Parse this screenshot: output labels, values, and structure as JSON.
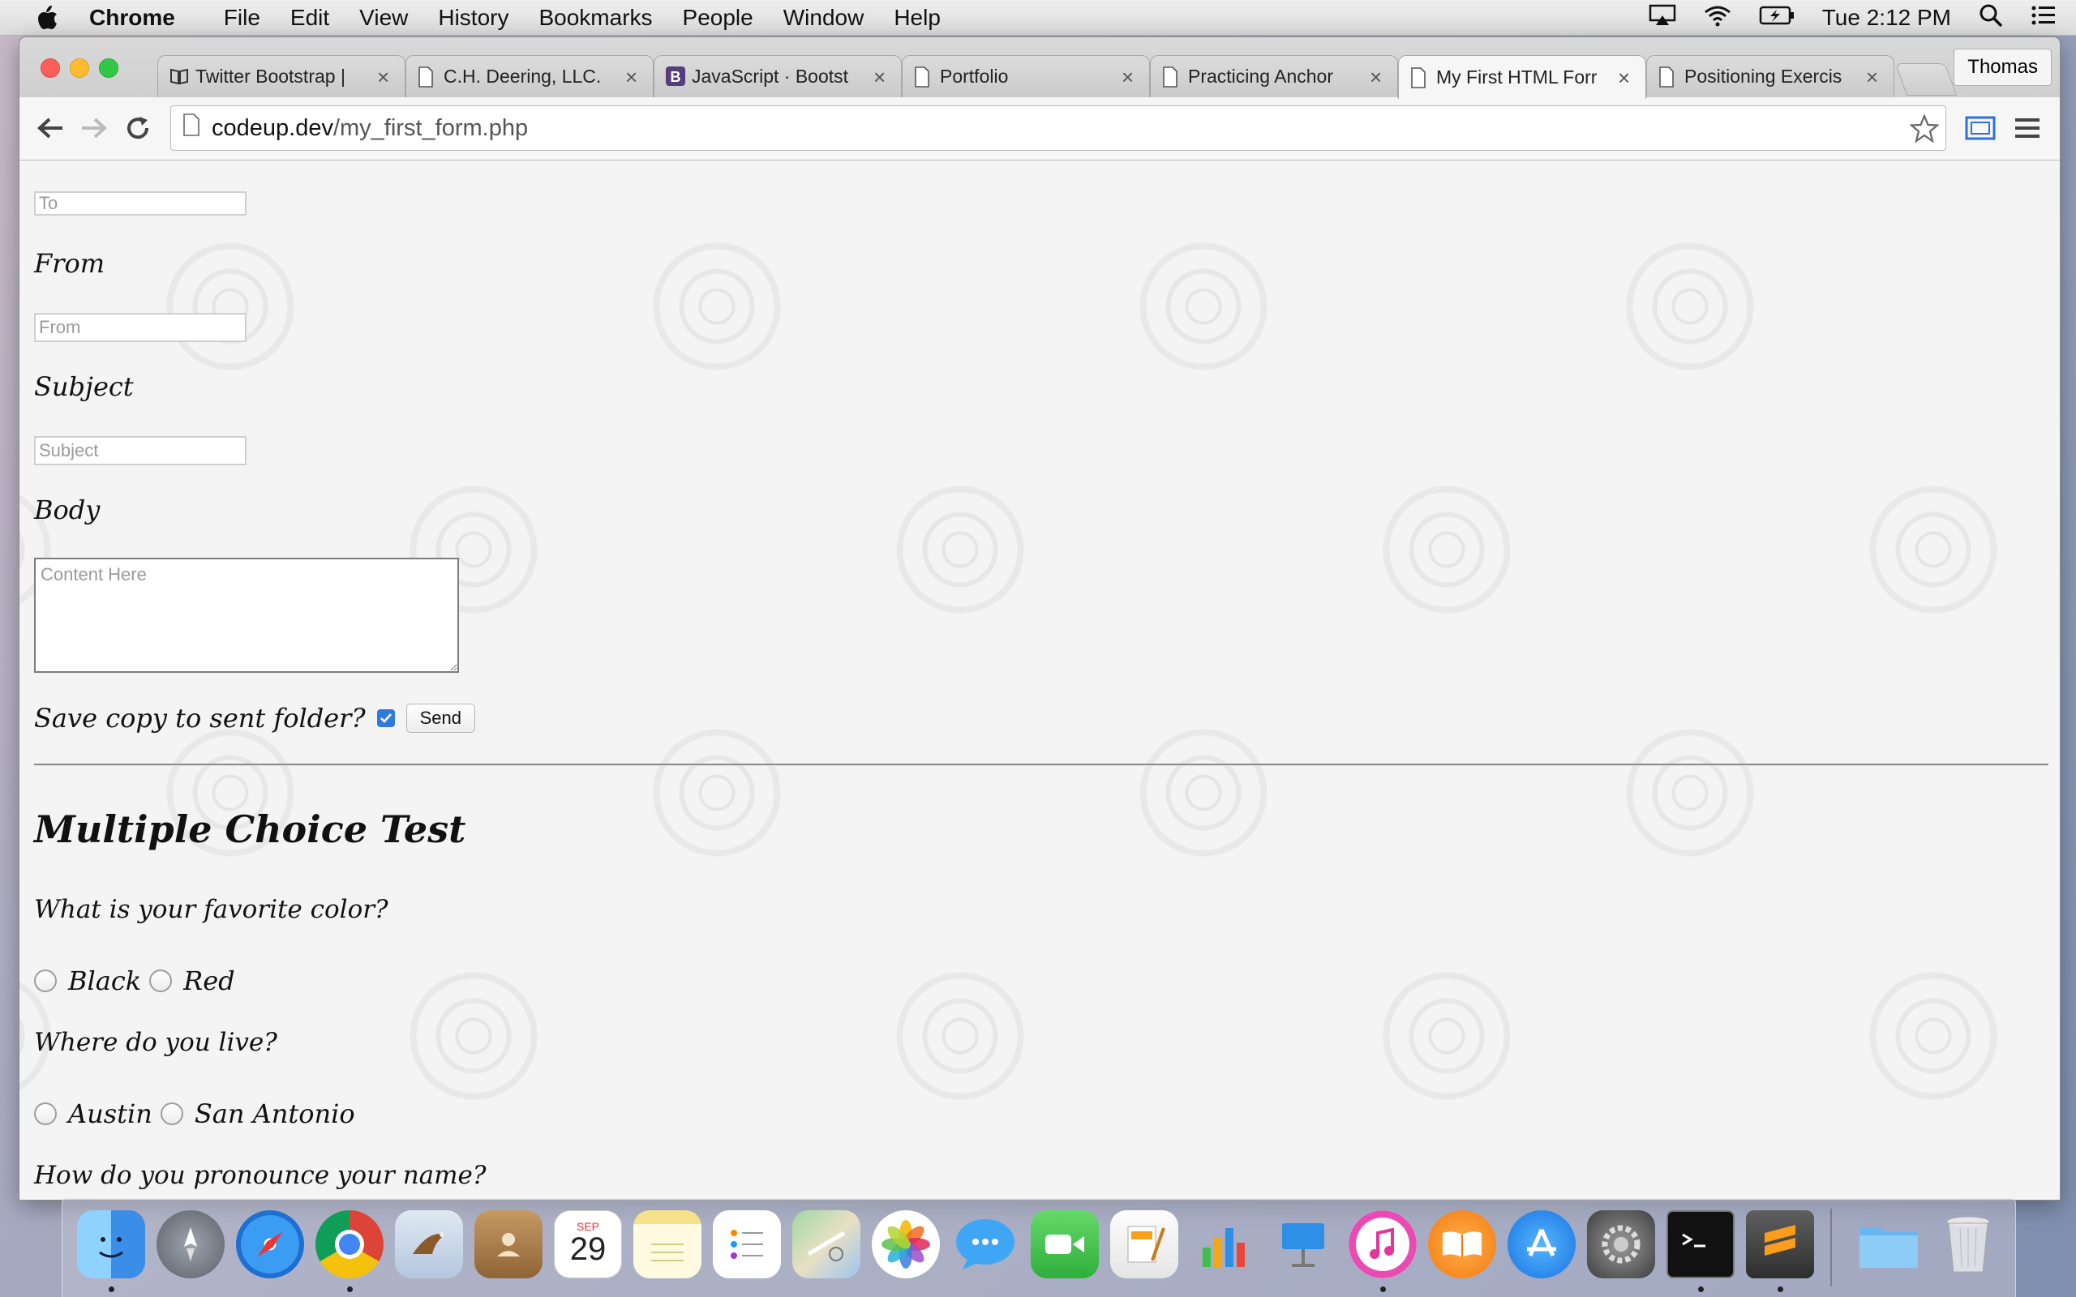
{
  "menubar": {
    "app_name": "Chrome",
    "items": [
      "File",
      "Edit",
      "View",
      "History",
      "Bookmarks",
      "People",
      "Window",
      "Help"
    ],
    "clock": "Tue 2:12 PM"
  },
  "browser": {
    "profile_name": "Thomas",
    "tabs": [
      {
        "title": "Twitter Bootstrap |",
        "icon": "book-icon"
      },
      {
        "title": "C.H. Deering, LLC.",
        "icon": "page-icon"
      },
      {
        "title": "JavaScript · Bootst",
        "icon": "bootstrap-icon"
      },
      {
        "title": "Portfolio",
        "icon": "page-icon"
      },
      {
        "title": "Practicing Anchor",
        "icon": "page-icon"
      },
      {
        "title": "My First HTML Forr",
        "icon": "page-icon"
      },
      {
        "title": "Positioning Exercis",
        "icon": "page-icon"
      }
    ],
    "active_tab_index": 5,
    "url_host": "codeup.dev",
    "url_path": "/my_first_form.php"
  },
  "form": {
    "to_placeholder": "To",
    "from_label": "From",
    "from_placeholder": "From",
    "subject_label": "Subject",
    "subject_placeholder": "Subject",
    "body_label": "Body",
    "body_placeholder": "Content Here",
    "save_copy_label": "Save copy to sent folder?",
    "save_copy_checked": true,
    "send_label": "Send"
  },
  "test": {
    "heading": "Multiple Choice Test",
    "q1": {
      "text": "What is your favorite color?",
      "options": [
        "Black",
        "Red"
      ]
    },
    "q2": {
      "text": "Where do you live?",
      "options": [
        "Austin",
        "San Antonio"
      ]
    },
    "q3": {
      "text": "How do you pronounce your name?"
    }
  },
  "dock": {
    "apps": [
      "finder-icon",
      "launchpad-icon",
      "safari-icon",
      "chrome-icon",
      "mail-icon",
      "contacts-icon",
      "calendar-icon",
      "notes-icon",
      "reminders-icon",
      "maps-icon",
      "photos-icon",
      "messages-icon",
      "facetime-icon",
      "pages-icon",
      "numbers-icon",
      "keynote-icon",
      "itunes-icon",
      "ibooks-icon",
      "app-store-icon",
      "system-preferences-icon",
      "terminal-icon",
      "sublime-text-icon",
      "folder-icon",
      "trash-icon"
    ],
    "calendar_month": "SEP",
    "calendar_day": "29"
  },
  "colors": {
    "accent_checkbox": "#2d7ae0",
    "close_red": "#fc5f57",
    "minimize_yellow": "#fdbc2e",
    "zoom_green": "#33c748"
  }
}
